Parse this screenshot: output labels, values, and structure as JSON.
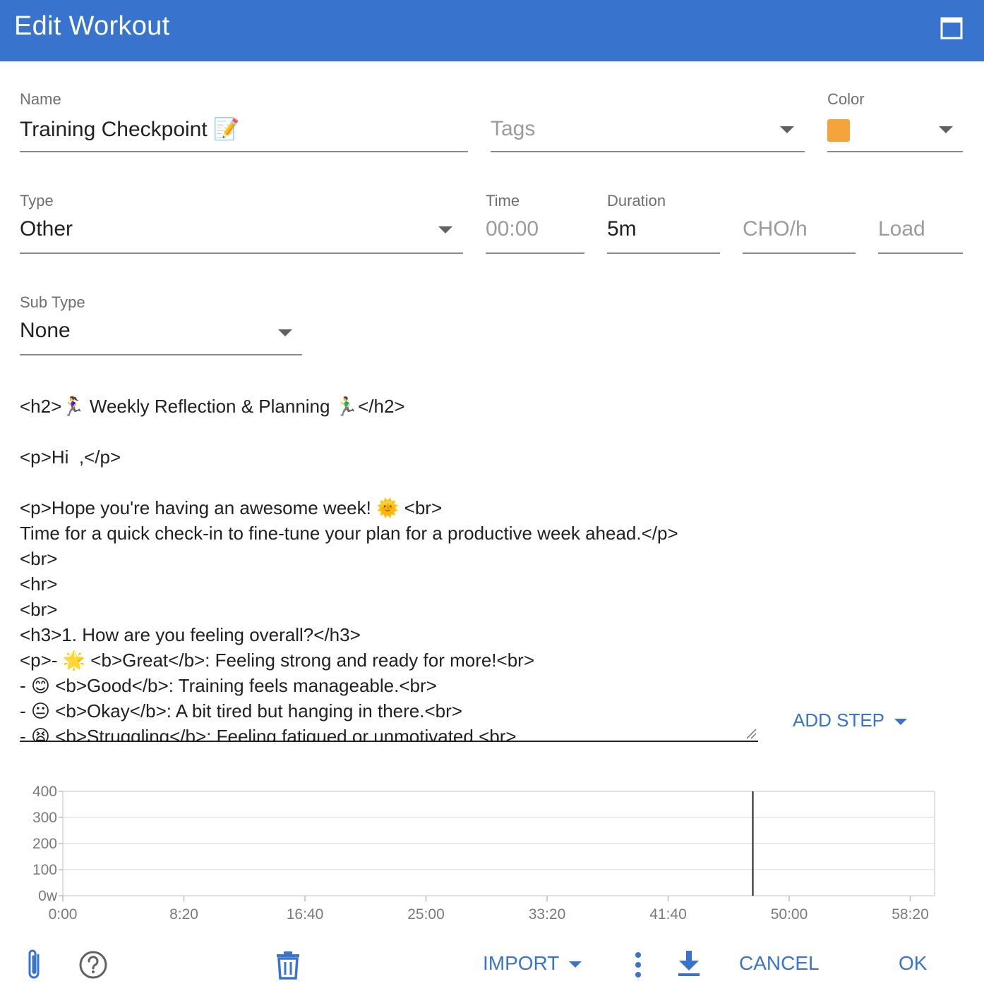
{
  "dialog": {
    "title": "Edit Workout"
  },
  "fields": {
    "name": {
      "label": "Name",
      "value": "Training Checkpoint 📝"
    },
    "tags": {
      "placeholder": "Tags"
    },
    "color": {
      "label": "Color",
      "value": "#f4a43a"
    },
    "type": {
      "label": "Type",
      "value": "Other"
    },
    "time": {
      "label": "Time",
      "placeholder": "00:00"
    },
    "duration": {
      "label": "Duration",
      "value": "5m"
    },
    "cho": {
      "placeholder": "CHO/h"
    },
    "load": {
      "placeholder": "Load"
    },
    "sub_type": {
      "label": "Sub Type",
      "value": "None"
    }
  },
  "notes": {
    "lines": [
      "<h2>🏃‍♀️ Weekly Reflection & Planning 🏃‍♂️</h2>",
      "",
      "<p>Hi  ,</p>",
      "",
      "<p>Hope you're having an awesome week! 🌞 <br>",
      "Time for a quick check-in to fine-tune your plan for a productive week ahead.</p>",
      "<br>",
      "<hr>",
      "<br>",
      "<h3>1. How are you feeling overall?</h3>",
      "<p>- 🌟 <b>Great</b>: Feeling strong and ready for more!<br>",
      "- 😊 <b>Good</b>: Training feels manageable.<br>",
      "- 😐 <b>Okay</b>: A bit tired but hanging in there.<br>",
      "- 😫 <b>Struggling</b>: Feeling fatigued or unmotivated.<br>"
    ]
  },
  "add_step": {
    "label": "ADD STEP"
  },
  "chart_data": {
    "type": "line",
    "y_ticks": [
      "400",
      "300",
      "200",
      "100",
      "0w"
    ],
    "x_ticks": [
      "0:00",
      "8:20",
      "16:40",
      "25:00",
      "33:20",
      "41:40",
      "50:00",
      "58:20"
    ],
    "ylim": [
      0,
      400
    ],
    "grid": true,
    "series": [],
    "marker_x_minutes": 47.5
  },
  "toolbar": {
    "attach_icon": "paperclip-icon",
    "help_icon": "help-circle-icon",
    "delete_icon": "trash-icon",
    "import_label": "IMPORT",
    "more_icon": "more-vert-icon",
    "download_icon": "download-icon",
    "cancel_label": "CANCEL",
    "ok_label": "OK"
  }
}
